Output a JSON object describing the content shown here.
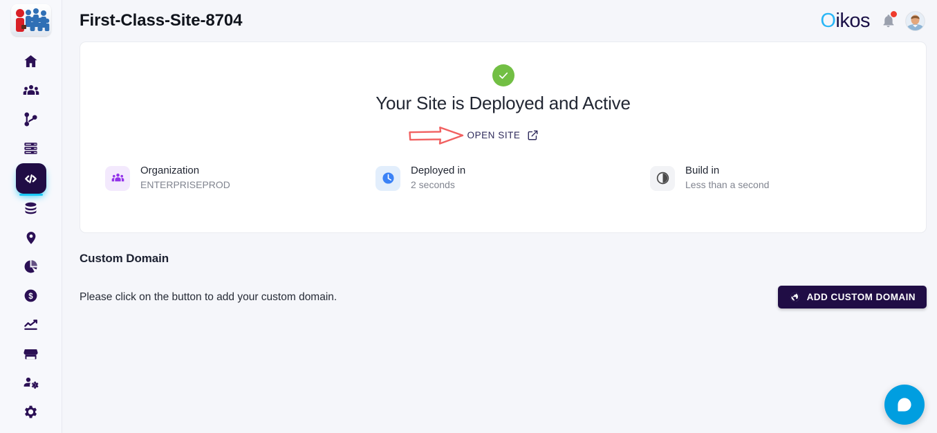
{
  "sidebar": {
    "logo_name": "people-group-logo",
    "items": [
      {
        "name": "home",
        "icon": "home-icon",
        "active": false
      },
      {
        "name": "teams",
        "icon": "people-icon",
        "active": false
      },
      {
        "name": "pipelines",
        "icon": "git-branch-icon",
        "active": false
      },
      {
        "name": "servers",
        "icon": "server-stack-icon",
        "active": false
      },
      {
        "name": "code",
        "icon": "code-brackets-icon",
        "active": true
      },
      {
        "name": "database",
        "icon": "database-icon",
        "active": false
      },
      {
        "name": "locations",
        "icon": "map-pin-icon",
        "active": false
      },
      {
        "name": "analytics",
        "icon": "pie-chart-icon",
        "active": false
      },
      {
        "name": "billing",
        "icon": "dollar-circle-icon",
        "active": false
      },
      {
        "name": "trends",
        "icon": "trending-up-icon",
        "active": false
      },
      {
        "name": "store",
        "icon": "storefront-icon",
        "active": false
      },
      {
        "name": "accounts",
        "icon": "manage-accounts-icon",
        "active": false
      },
      {
        "name": "settings",
        "icon": "gear-icon",
        "active": false
      }
    ]
  },
  "header": {
    "title": "First-Class-Site-8704",
    "brand": {
      "first_letter": "O",
      "rest": "ikos",
      "accent_color": "#29b6f6",
      "text_color": "#1a1046"
    },
    "notification_icon": "bell-icon",
    "notification_badge": true,
    "avatar_icon": "user-avatar"
  },
  "deploy_card": {
    "status_icon": "green-check-circle",
    "status_color": "#72bf44",
    "heading": "Your Site is Deployed and Active",
    "open_site_label": "OPEN SITE",
    "open_site_icon": "external-link-icon",
    "annotation_arrow": {
      "icon": "hand-drawn-arrow",
      "color": "#ef4444"
    },
    "stats": [
      {
        "icon": "organization-people-icon",
        "icon_style": "purple",
        "label": "Organization",
        "value": "ENTERPRISEPROD"
      },
      {
        "icon": "clock-icon",
        "icon_style": "blue",
        "label": "Deployed in",
        "value": "2 seconds"
      },
      {
        "icon": "half-circle-timer-icon",
        "icon_style": "grey",
        "label": "Build in",
        "value": "Less than a second"
      }
    ]
  },
  "custom_domain": {
    "title": "Custom Domain",
    "description": "Please click on the button to add your custom domain.",
    "button_label": "ADD CUSTOM DOMAIN",
    "button_icon": "globe-icon",
    "button_color": "#200d45"
  },
  "chat_widget": {
    "icon": "chat-bubble-icon",
    "color": "#009ee0"
  }
}
